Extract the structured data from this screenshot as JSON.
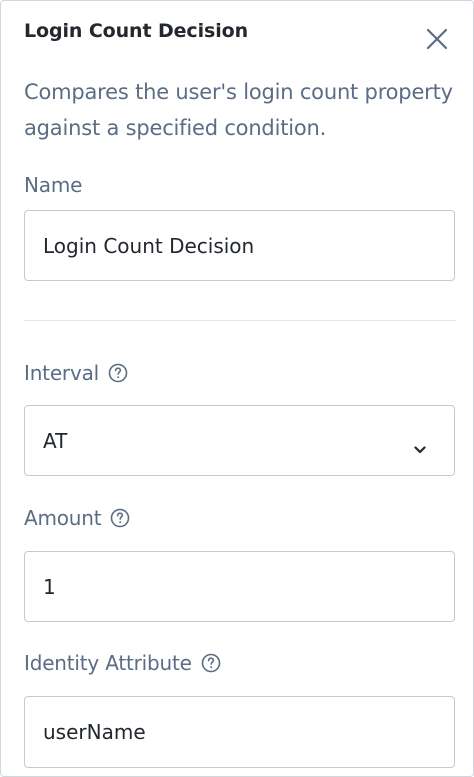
{
  "panel": {
    "title": "Login Count Decision",
    "description": "Compares the user's login count property against a specified condition."
  },
  "fields": {
    "name": {
      "label": "Name",
      "value": "Login Count Decision"
    },
    "interval": {
      "label": "Interval",
      "value": "AT"
    },
    "amount": {
      "label": "Amount",
      "value": "1"
    },
    "identity_attribute": {
      "label": "Identity Attribute",
      "value": "userName"
    }
  },
  "icons": {
    "close": "close-icon",
    "help": "help-circle-icon",
    "dropdown": "chevron-down-icon"
  },
  "colors": {
    "title": "#23282e",
    "muted_text": "#5b6d84",
    "border": "#c5cad2"
  }
}
